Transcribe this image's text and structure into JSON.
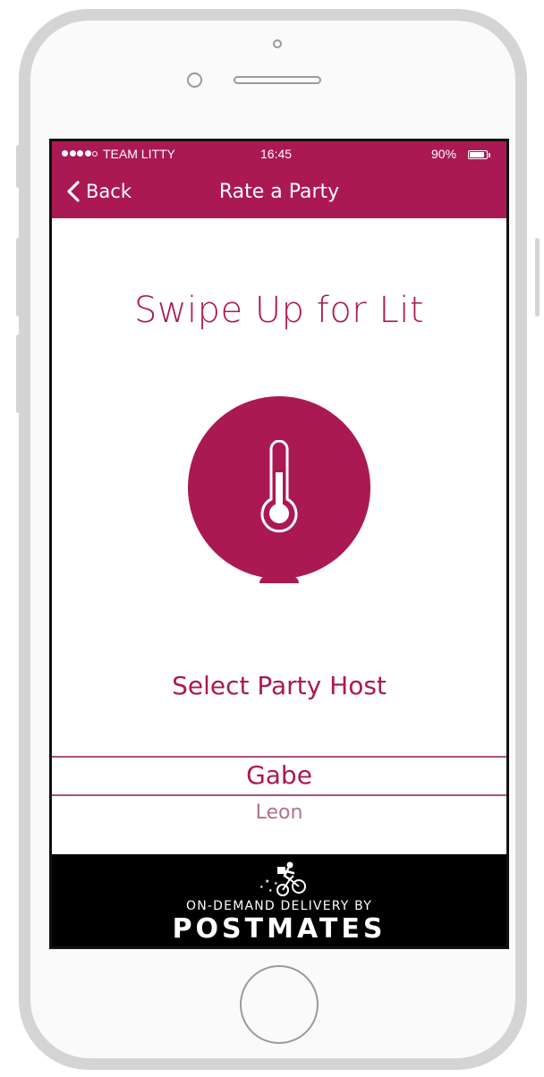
{
  "status_bar": {
    "carrier": "TEAM LITTY",
    "time": "16:45",
    "battery_percent": "90%",
    "battery_level": 0.9,
    "signal_bars_filled": 4,
    "signal_bars_total": 5
  },
  "nav": {
    "back_label": "Back",
    "title": "Rate a Party"
  },
  "main": {
    "headline": "Swipe Up for Lit",
    "lit_icon": "thermometer-icon",
    "host_label": "Select Party Host",
    "picker": {
      "selected": "Gabe",
      "next": "Leon"
    }
  },
  "ad": {
    "icon": "bike-courier-icon",
    "tagline": "ON-DEMAND DELIVERY BY",
    "brand": "POSTMATES"
  },
  "colors": {
    "accent": "#ab1952",
    "ad_background": "#000000"
  }
}
